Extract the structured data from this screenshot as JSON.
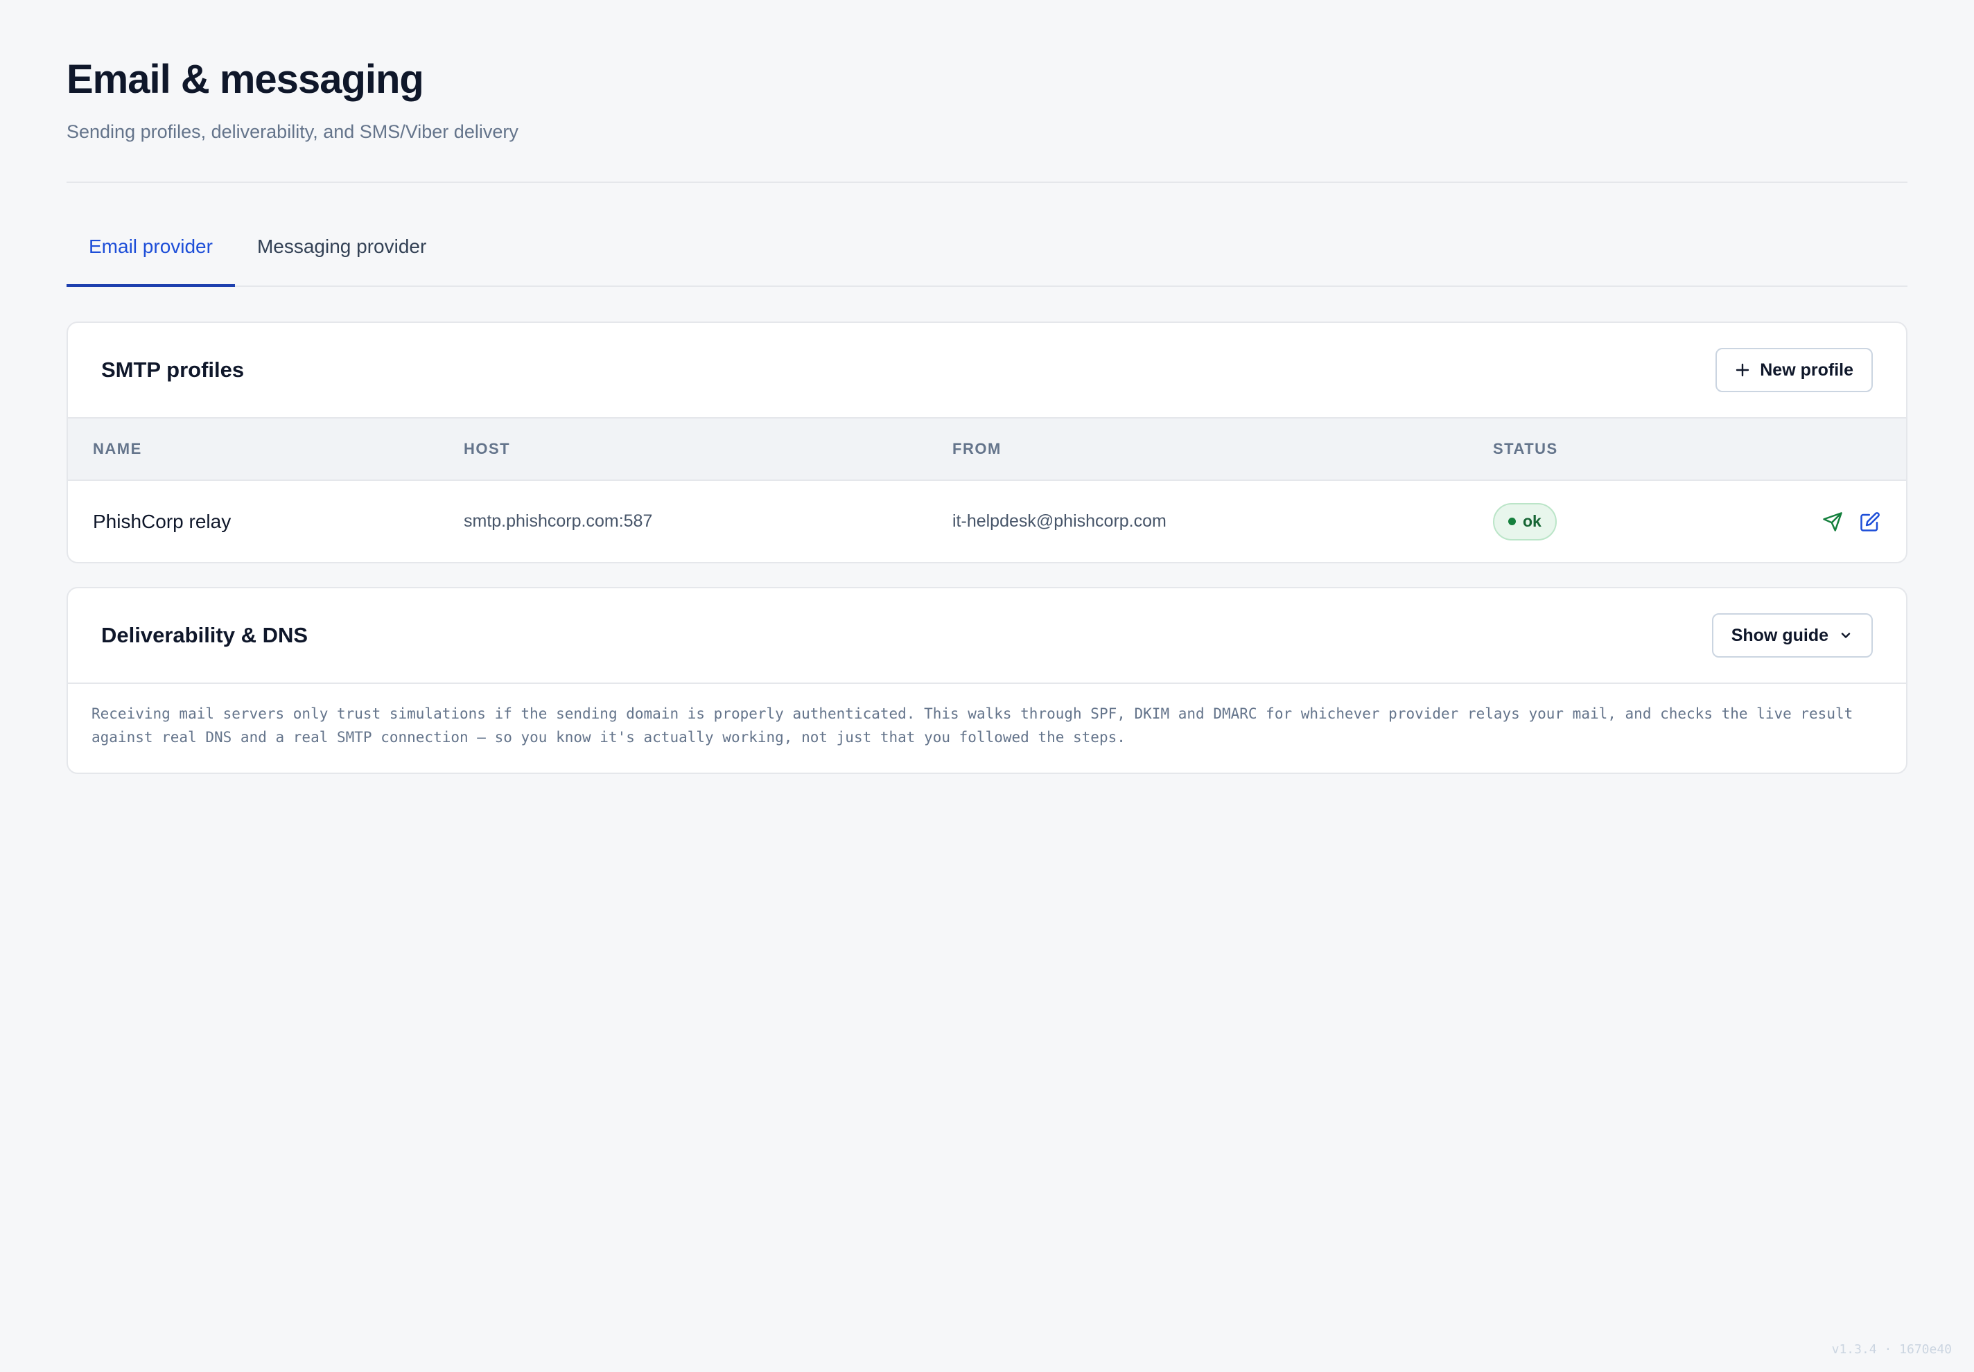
{
  "header": {
    "title": "Email & messaging",
    "subtitle": "Sending profiles, deliverability, and SMS/Viber delivery"
  },
  "tabs": [
    {
      "label": "Email provider",
      "active": true
    },
    {
      "label": "Messaging provider",
      "active": false
    }
  ],
  "smtp": {
    "title": "SMTP profiles",
    "new_button": "New profile",
    "columns": [
      "NAME",
      "HOST",
      "FROM",
      "STATUS"
    ],
    "rows": [
      {
        "name": "PhishCorp relay",
        "host": "smtp.phishcorp.com:587",
        "from": "it-helpdesk@phishcorp.com",
        "status": "ok"
      }
    ]
  },
  "deliverability": {
    "title": "Deliverability & DNS",
    "guide_button": "Show guide",
    "description": "Receiving mail servers only trust simulations if the sending domain is properly authenticated. This walks through SPF, DKIM and DMARC for whichever provider relays your mail, and checks the live result against real DNS and a real SMTP connection — so you know it's actually working, not just that you followed the steps."
  },
  "footer": {
    "version": "v1.3.4 · 1670e40"
  },
  "colors": {
    "accent": "#1e40af",
    "status_ok": "#15803d",
    "send_icon": "#15803d",
    "edit_icon": "#1d4ed8"
  },
  "icons": {
    "new_profile": "plus-icon",
    "show_guide": "chevron-down-icon",
    "row_send": "send-icon",
    "row_edit": "edit-icon"
  }
}
